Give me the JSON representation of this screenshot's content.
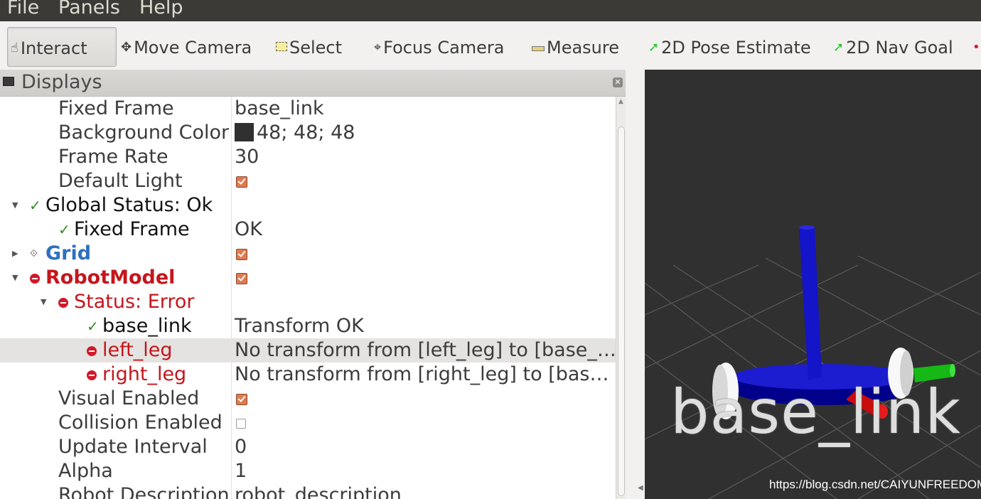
{
  "menu": {
    "file": "File",
    "panels": "Panels",
    "help": "Help"
  },
  "toolbar": {
    "interact": "Interact",
    "move_camera": "Move Camera",
    "select": "Select",
    "focus_camera": "Focus Camera",
    "measure": "Measure",
    "pose_estimate": "2D Pose Estimate",
    "nav_goal": "2D Nav Goal"
  },
  "displays": {
    "title": "Displays",
    "rows": {
      "fixed_frame": {
        "name": "Fixed Frame",
        "value": "base_link"
      },
      "background_color": {
        "name": "Background Color",
        "value": "48; 48; 48",
        "swatch": "#303030"
      },
      "frame_rate": {
        "name": "Frame Rate",
        "value": "30"
      },
      "default_light": {
        "name": "Default Light",
        "checked": true
      },
      "global_status": {
        "name": "Global Status: Ok"
      },
      "global_fixed_frame": {
        "name": "Fixed Frame",
        "value": "OK"
      },
      "grid": {
        "name": "Grid",
        "checked": true
      },
      "robot_model": {
        "name": "RobotModel",
        "checked": true
      },
      "status_error": {
        "name": "Status: Error"
      },
      "base_link": {
        "name": "base_link",
        "value": "Transform OK"
      },
      "left_leg": {
        "name": "left_leg",
        "value": "No transform from [left_leg] to [base_…"
      },
      "right_leg": {
        "name": "right_leg",
        "value": "No transform from [right_leg] to [bas…"
      },
      "visual_enabled": {
        "name": "Visual Enabled",
        "checked": true
      },
      "collision_enabled": {
        "name": "Collision Enabled",
        "checked": false
      },
      "update_interval": {
        "name": "Update Interval",
        "value": "0"
      },
      "alpha": {
        "name": "Alpha",
        "value": "1"
      },
      "robot_description": {
        "name": "Robot Description",
        "value": "robot_description"
      }
    }
  },
  "view3d": {
    "frame_label": "base_link",
    "watermark": "https://blog.csdn.net/CAIYUNFREEDOM"
  },
  "colors": {
    "error_red": "#c4161c",
    "grid_blue": "#2f6fbf",
    "ok_green": "#2e8b20",
    "checkbox_orange": "#e07a4f",
    "viewport_bg": "#303030"
  }
}
